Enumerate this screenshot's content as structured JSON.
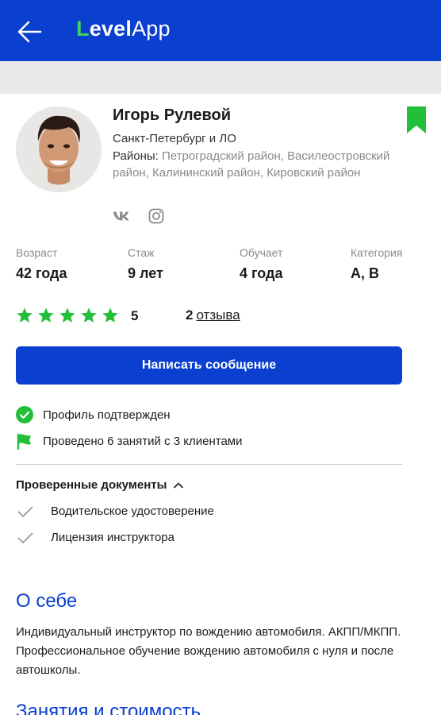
{
  "header": {
    "logo_first_letter": "L",
    "logo_bold_rest": "evel",
    "logo_regular": "App",
    "back_icon": "arrow-left-icon",
    "colors": {
      "bar": "#0a3fcf",
      "logo_accent": "#3fd461"
    }
  },
  "profile": {
    "name": "Игорь Рулевой",
    "city": "Санкт-Петербург и ЛО",
    "areas_label": "Районы:",
    "areas_value": "Петроградский район, Василеостровский район, Калининский район, Кировский район",
    "bookmark_icon": "bookmark-icon",
    "bookmark_color": "#22c03a",
    "social": [
      "vk-icon",
      "instagram-icon"
    ]
  },
  "stats": [
    {
      "label": "Возраст",
      "value": "42 года"
    },
    {
      "label": "Стаж",
      "value": "9 лет"
    },
    {
      "label": "Обучает",
      "value": "4 года"
    },
    {
      "label": "Категория",
      "value": "A, B"
    }
  ],
  "rating": {
    "stars": 5,
    "value": "5",
    "reviews_count": "2",
    "reviews_label": "отзыва",
    "star_color": "#22c03a"
  },
  "actions": {
    "message_button": "Написать сообщение"
  },
  "info": {
    "verified": "Профиль подтвержден",
    "lessons": "Проведено 6 занятий с 3 клиентами"
  },
  "documents": {
    "title": "Проверенные документы",
    "items": [
      "Водительское удостоверение",
      "Лицензия инструктора"
    ]
  },
  "about": {
    "title": "О себе",
    "text": "Индивидуальный инструктор по вождению автомобиля. АКПП/МКПП. Профессиональное обучение вождению автомобиля с нуля и после автошколы."
  },
  "lessons_section": {
    "title": "Занятия и стоимость"
  }
}
